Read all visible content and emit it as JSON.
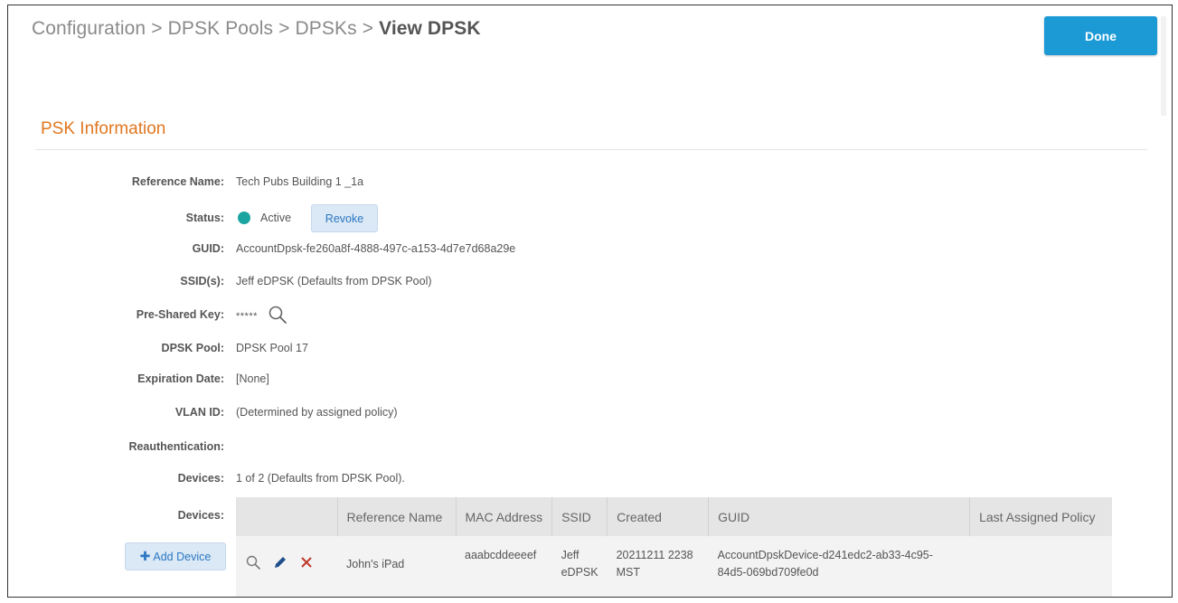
{
  "breadcrumb": {
    "items": [
      "Configuration",
      "DPSK Pools",
      "DPSKs"
    ],
    "separator": ">",
    "current": "View DPSK"
  },
  "header": {
    "done_label": "Done"
  },
  "section": {
    "title": "PSK Information"
  },
  "fields": {
    "reference_name": {
      "label": "Reference Name:",
      "value": "Tech Pubs Building 1 _1a"
    },
    "status": {
      "label": "Status:",
      "value": "Active",
      "revoke_label": "Revoke",
      "dot_color": "#1aa5a0"
    },
    "guid": {
      "label": "GUID:",
      "value": "AccountDpsk-fe260a8f-4888-497c-a153-4d7e7d68a29e"
    },
    "ssids": {
      "label": "SSID(s):",
      "value": "Jeff eDPSK (Defaults from DPSK Pool)"
    },
    "psk": {
      "label": "Pre-Shared Key:",
      "value": "*****",
      "icon": "search-icon"
    },
    "dpsk_pool": {
      "label": "DPSK Pool:",
      "value": "DPSK Pool 17"
    },
    "expiration": {
      "label": "Expiration Date:",
      "value": "[None]"
    },
    "vlan": {
      "label": "VLAN ID:",
      "value": "(Determined by assigned policy)"
    },
    "reauth": {
      "label": "Reauthentication:",
      "value": ""
    },
    "devices_count": {
      "label": "Devices:",
      "value": "1 of 2 (Defaults from DPSK Pool)."
    },
    "devices_table": {
      "label": "Devices:"
    }
  },
  "add_device_label": "Add Device",
  "devices_table": {
    "columns": [
      "",
      "Reference Name",
      "MAC Address",
      "SSID",
      "Created",
      "GUID",
      "Last Assigned Policy"
    ],
    "rows": [
      {
        "reference_name": "John's iPad",
        "mac": "aaabcddeeeef",
        "ssid_line1": "Jeff",
        "ssid_line2": "eDPSK",
        "created_line1": "20211211 2238",
        "created_line2": "MST",
        "guid_line1": "AccountDpskDevice-d241edc2-ab33-4c95-",
        "guid_line2": "84d5-069bd709fe0d",
        "last_policy": ""
      }
    ]
  },
  "colors": {
    "accent_orange": "#e0771f",
    "done_blue": "#1b9ad6",
    "link_blue": "#2b78c2",
    "delete_red": "#c0392b"
  }
}
